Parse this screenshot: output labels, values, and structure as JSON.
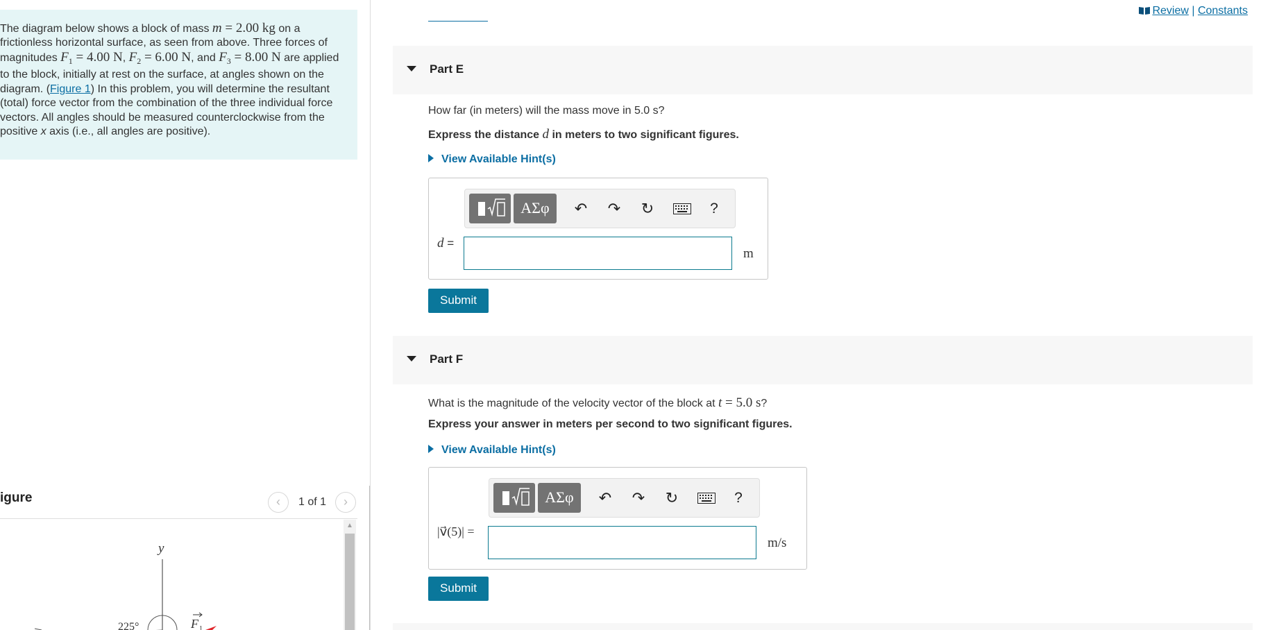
{
  "intro": {
    "text_1": "The diagram below shows a block of mass ",
    "m_sym": "m",
    "m_val": " = 2.00 kg",
    "text_2": " on a frictionless horizontal surface, as seen from above. Three forces of magnitudes ",
    "f1_sym": "F",
    "f1_sub": "1",
    "f1_val": " = 4.00 N",
    "comma_1": ", ",
    "f2_sym": "F",
    "f2_sub": "2",
    "f2_val": " = 6.00 N",
    "and_text": ", and ",
    "f3_sym": "F",
    "f3_sub": "3",
    "f3_val": " = 8.00 N",
    "text_3": " are applied to the block, initially at rest on the surface, at angles shown on the diagram. (",
    "figure_link": "Figure 1",
    "text_4": ") In this problem, you will determine the resultant (total) force vector from the combination of the three individual force vectors. All angles should be measured counterclockwise from the positive ",
    "x_axis": "x",
    "text_5": " axis (i.e., all angles are positive)."
  },
  "figure": {
    "heading": "igure",
    "counter": "1 of 1",
    "prev_glyph": "‹",
    "next_glyph": "›",
    "y_label": "y",
    "f1_label": "F",
    "f1_sub": "1",
    "angle_label": "225°"
  },
  "top_links": {
    "review": "Review",
    "separator": " | ",
    "constants": "Constants"
  },
  "part_e": {
    "title": "Part E",
    "question": "How far (in meters) will the mass move in 5.0 s?",
    "instr_1": "Express the distance ",
    "instr_var": "d",
    "instr_2": " in meters to two significant figures.",
    "hint": "View Available Hint(s)",
    "toolbar_greek": "ΑΣφ",
    "toolbar_help": "?",
    "label_var": "d",
    "label_eq": " =",
    "input_value": "",
    "unit": "m",
    "submit": "Submit"
  },
  "part_f": {
    "title": "Part F",
    "question_1": "What is the magnitude of the velocity vector of the block at ",
    "question_var": "t",
    "question_2": " = 5.0 s",
    "question_3": "?",
    "instr": "Express your answer in meters per second to two significant figures.",
    "hint": "View Available Hint(s)",
    "toolbar_greek": "ΑΣφ",
    "toolbar_help": "?",
    "label": "|v⃗(5)| =",
    "input_value": "",
    "unit": "m/s",
    "submit": "Submit"
  },
  "colors": {
    "link": "#0b6ea3",
    "intro_bg": "#e5f5f6",
    "submit_bg": "#0a779b",
    "part_header_bg": "#f7f7f7"
  }
}
